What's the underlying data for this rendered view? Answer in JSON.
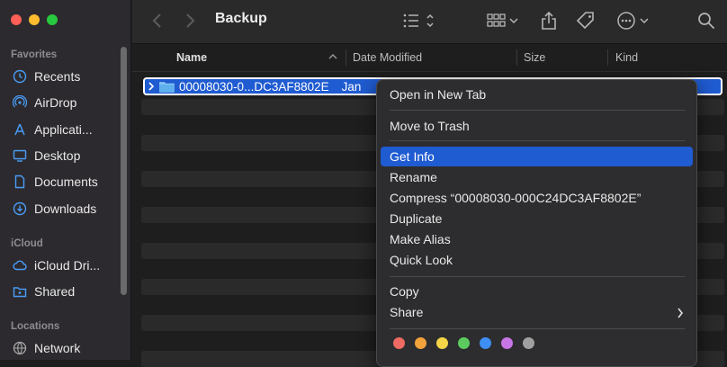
{
  "window": {
    "title": "Backup"
  },
  "sidebar": {
    "favorites_label": "Favorites",
    "favorites": [
      "Recents",
      "AirDrop",
      "Applicati...",
      "Desktop",
      "Documents",
      "Downloads"
    ],
    "icloud_label": "iCloud",
    "icloud": [
      "iCloud Dri...",
      "Shared"
    ],
    "locations_label": "Locations",
    "locations": [
      "Network"
    ]
  },
  "columns": {
    "name": "Name",
    "date_modified": "Date Modified",
    "size": "Size",
    "kind": "Kind"
  },
  "file": {
    "name": "00008030-0...DC3AF8802E",
    "date_partial": "Jan"
  },
  "context_menu": {
    "items": [
      "Open in New Tab",
      "Move to Trash",
      "Get Info",
      "Rename",
      "Compress “00008030-000C24DC3AF8802E”",
      "Duplicate",
      "Make Alias",
      "Quick Look",
      "Copy",
      "Share"
    ],
    "highlighted": "Get Info",
    "tag_colors": [
      "#ef6a62",
      "#f3a33c",
      "#f5d547",
      "#5ccb5f",
      "#3d8ff5",
      "#c875e6",
      "#a0a0a0"
    ]
  },
  "colors": {
    "accent": "#1f5bd1",
    "sidebar_icon": "#4a9cf7"
  }
}
